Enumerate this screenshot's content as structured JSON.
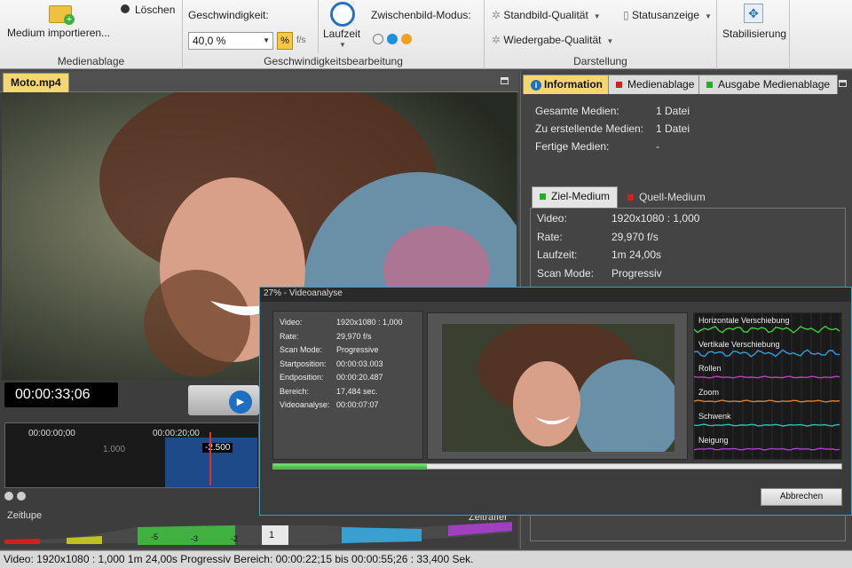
{
  "ribbon": {
    "medienablage": {
      "import_label": "Medium importieren...",
      "delete_label": "Löschen",
      "group_label": "Medienablage"
    },
    "speed": {
      "label": "Geschwindigkeit:",
      "value": "40,0 %",
      "unit": "f/s",
      "runtime_label": "Laufzeit",
      "interframe_label": "Zwischenbild-Modus:",
      "group_label": "Geschwindigkeitsbearbeitung"
    },
    "display": {
      "still_quality": "Standbild-Qualität",
      "status_display": "Statusanzeige",
      "playback_quality": "Wiedergabe-Qualität",
      "group_label": "Darstellung"
    },
    "stabilize_label": "Stabilisierung"
  },
  "left_tab": "Moto.mp4",
  "timecode": "00:00:33;06",
  "timeline": {
    "start": "00:00:00;00",
    "marker": "00:00:20;00",
    "scale_mark": "1.000",
    "speed_mark": "-2.500"
  },
  "zeitlupe": {
    "label": "Zeitlupe",
    "right_label": "Zeitraffer",
    "center": "1",
    "marks": [
      "-5",
      "-3",
      "-2"
    ]
  },
  "right_tabs": [
    "Information",
    "Medienablage",
    "Ausgabe Medienablage"
  ],
  "info": [
    {
      "label": "Gesamte Medien:",
      "value": "1 Datei"
    },
    {
      "label": "Zu erstellende Medien:",
      "value": "1 Datei"
    },
    {
      "label": "Fertige Medien:",
      "value": "-"
    }
  ],
  "medium_tabs": [
    "Ziel-Medium",
    "Quell-Medium"
  ],
  "medium": [
    {
      "label": "Video:",
      "value": "1920x1080 : 1,000"
    },
    {
      "label": "Rate:",
      "value": "29,970 f/s"
    },
    {
      "label": "Laufzeit:",
      "value": "1m 24,00s"
    },
    {
      "label": "Scan Mode:",
      "value": "Progressiv"
    }
  ],
  "dialog": {
    "title": "27% - Videoanalyse",
    "progress": 0.27,
    "rows": [
      {
        "label": "Video:",
        "value": "1920x1080 : 1,000"
      },
      {
        "label": "Rate:",
        "value": "29,970 f/s"
      },
      {
        "label": "Scan Mode:",
        "value": "Progressive"
      },
      {
        "label": "Startposition:",
        "value": "00:00:03.003"
      },
      {
        "label": "Endposition:",
        "value": "00:00:20.487"
      },
      {
        "label": "Bereich:",
        "value": "17,484 sec."
      },
      {
        "label": "Videoanalyse:",
        "value": "00:00:07:07"
      }
    ],
    "graphs": [
      {
        "label": "Horizontale Verschiebung",
        "color": "#3cd23c"
      },
      {
        "label": "Vertikale Verschiebung",
        "color": "#2ea0e0"
      },
      {
        "label": "Rollen",
        "color": "#c040c0"
      },
      {
        "label": "Zoom",
        "color": "#e08030"
      },
      {
        "label": "Schwenk",
        "color": "#30c0c0"
      },
      {
        "label": "Neigung",
        "color": "#b040d0"
      }
    ],
    "cancel_label": "Abbrechen"
  },
  "status": "Video: 1920x1080 : 1,000   1m 24,00s   Progressiv   Bereich: 00:00:22;15 bis 00:00:55;26 : 33,400 Sek."
}
